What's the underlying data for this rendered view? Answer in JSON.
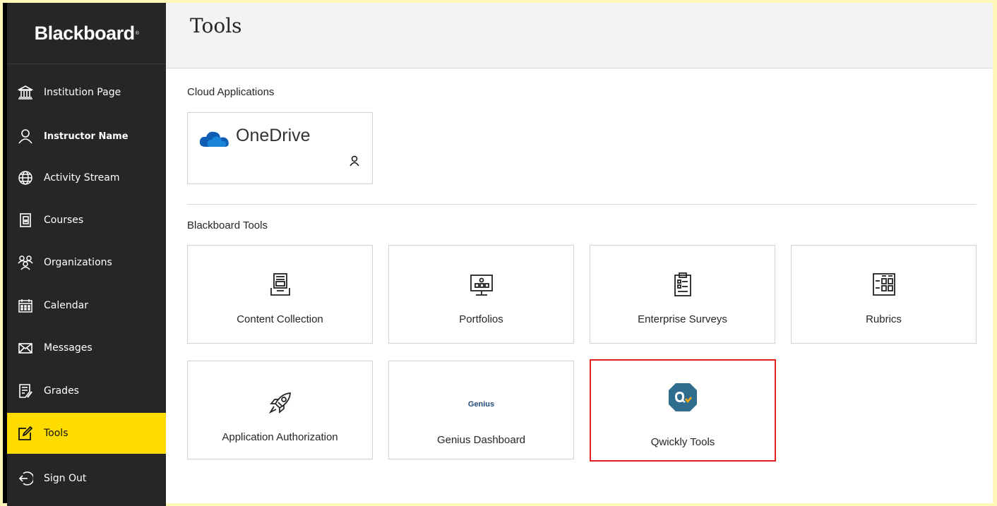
{
  "brand": {
    "name": "Blackboard",
    "mark": "®"
  },
  "sidebar": {
    "items": [
      {
        "label": "Institution Page",
        "icon": "institution-icon"
      },
      {
        "label": "Instructor Name",
        "icon": "user-icon"
      },
      {
        "label": "Activity Stream",
        "icon": "globe-icon"
      },
      {
        "label": "Courses",
        "icon": "courses-icon"
      },
      {
        "label": "Organizations",
        "icon": "organizations-icon"
      },
      {
        "label": "Calendar",
        "icon": "calendar-icon"
      },
      {
        "label": "Messages",
        "icon": "envelope-icon"
      },
      {
        "label": "Grades",
        "icon": "grades-icon"
      },
      {
        "label": "Tools",
        "icon": "tools-icon",
        "active": true
      },
      {
        "label": "Sign Out",
        "icon": "sign-out-icon"
      }
    ]
  },
  "page": {
    "title": "Tools"
  },
  "cloud": {
    "title": "Cloud Applications",
    "onedrive": {
      "label": "OneDrive",
      "icon": "onedrive-cloud-icon"
    }
  },
  "bbtools": {
    "title": "Blackboard Tools",
    "tiles": [
      {
        "label": "Content Collection",
        "icon": "content-collection-icon"
      },
      {
        "label": "Portfolios",
        "icon": "portfolios-icon"
      },
      {
        "label": "Enterprise Surveys",
        "icon": "clipboard-icon"
      },
      {
        "label": "Rubrics",
        "icon": "rubrics-icon"
      },
      {
        "label": "Application Authorization",
        "icon": "rocket-icon"
      },
      {
        "label": "Genius Dashboard",
        "icon": "genius-logo",
        "logo_text": "Genius"
      },
      {
        "label": "Qwickly Tools",
        "icon": "qwickly-logo",
        "highlighted": true
      }
    ]
  },
  "colors": {
    "sidebar_bg": "#262626",
    "active_bg": "#ffdc00",
    "highlight_border": "#e0201f",
    "onedrive_blue": "#0f5eb4",
    "qwickly_bg": "#2f6c8d",
    "qwickly_accent": "#f0a818"
  }
}
